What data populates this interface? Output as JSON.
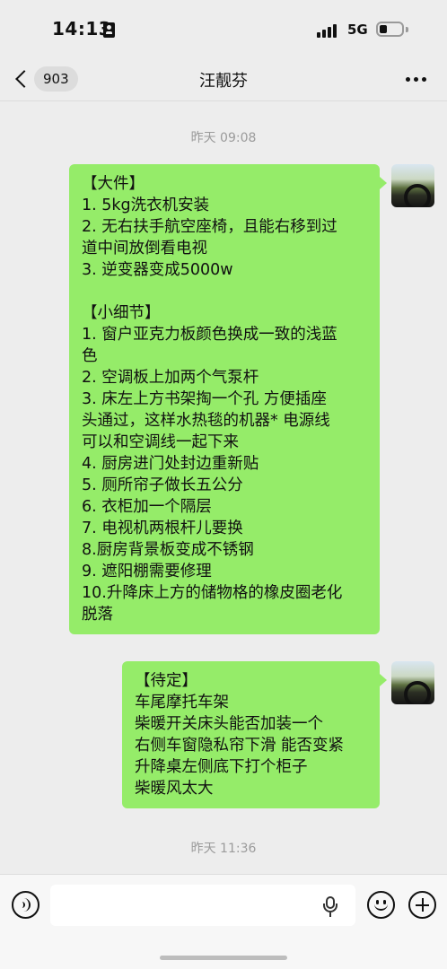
{
  "status_bar": {
    "time": "14:13",
    "network": "5G"
  },
  "nav": {
    "back_badge": "903",
    "title": "汪靓芬"
  },
  "messages": [
    {
      "timestamp": "昨天 09:08",
      "sender": "self",
      "lines": [
        "【大件】",
        "1. 5kg洗衣机安装",
        "2. 无右扶手航空座椅，且能右移到过",
        "道中间放倒看电视",
        "3. 逆变器变成5000w",
        "",
        "【小细节】",
        "1. 窗户亚克力板颜色换成一致的浅蓝",
        "色",
        "2. 空调板上加两个气泵杆",
        "3. 床左上方书架掏一个孔 方便插座",
        "头通过，这样水热毯的机器* 电源线",
        "可以和空调线一起下来",
        "4. 厨房进门处封边重新贴",
        "5. 厕所帘子做长五公分",
        "6. 衣柜加一个隔层",
        "7. 电视机两根杆儿要换",
        "8.厨房背景板变成不锈钢",
        "9. 遮阳棚需要修理",
        "10.升降床上方的储物格的橡皮圈老化",
        "脱落"
      ]
    },
    {
      "sender": "self",
      "lines": [
        "【待定】",
        "车尾摩托车架",
        "柴暖开关床头能否加装一个",
        "右侧车窗隐私帘下滑 能否变紧",
        "升降桌左侧底下打个柜子",
        "柴暖风太大"
      ]
    },
    {
      "timestamp": "昨天 11:36"
    }
  ],
  "input_bar": {
    "placeholder": ""
  },
  "icons": {
    "voice": "voice-icon",
    "mic": "mic-icon",
    "emoji": "emoji-icon",
    "add": "add-icon"
  },
  "colors": {
    "bubble": "#95ec69",
    "background": "#ededed"
  }
}
